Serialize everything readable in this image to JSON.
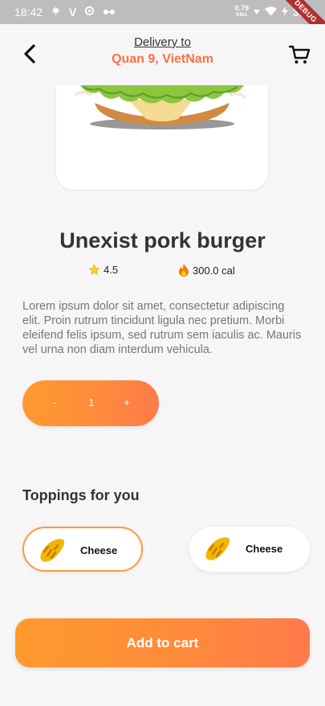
{
  "status_bar": {
    "time": "18:42",
    "net_speed_value": "0.79",
    "net_speed_unit": "KB/s",
    "battery": "39%",
    "debug_ribbon": "DEBUG"
  },
  "header": {
    "delivery_label": "Delivery to",
    "delivery_location": "Quan 9, VietNam"
  },
  "product": {
    "title": "Unexist pork burger",
    "rating": "4.5",
    "calories": "300.0 cal",
    "description": "Lorem ipsum dolor sit amet, consectetur adipiscing elit. Proin rutrum tincidunt ligula nec pretium. Morbi eleifend felis ipsum, sed rutrum sem iaculis ac. Mauris vel urna non diam interdum vehicula."
  },
  "quantity": {
    "minus_label": "-",
    "value": "1",
    "plus_label": "+"
  },
  "toppings": {
    "title": "Toppings for you",
    "items": [
      {
        "label": "Cheese",
        "selected": true
      },
      {
        "label": "Cheese",
        "selected": false
      }
    ]
  },
  "actions": {
    "add_to_cart_label": "Add to cart"
  },
  "colors": {
    "accent": "#ff7043",
    "gradient_start": "#ff9a2e",
    "gradient_end": "#ff7a4a",
    "background": "#f6f6f6"
  }
}
